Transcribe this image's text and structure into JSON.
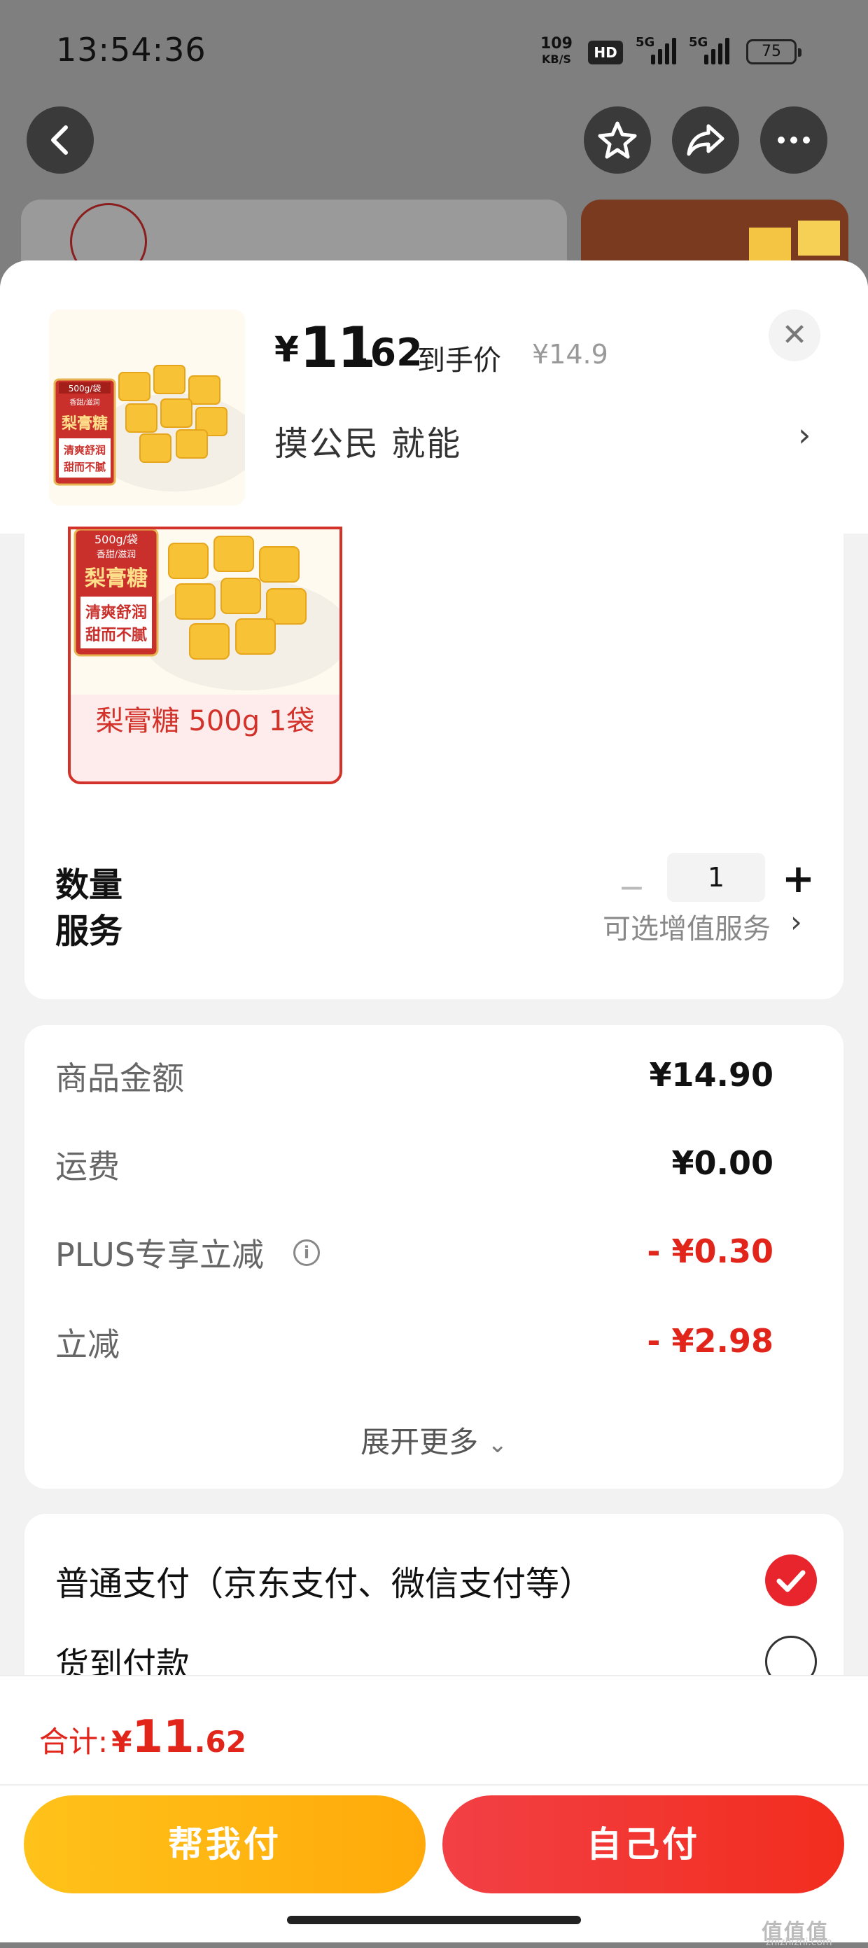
{
  "status_bar": {
    "time": "13:54:36",
    "net_speed_value": "109",
    "net_speed_unit": "KB/S",
    "hd_label": "HD",
    "sig1_label": "5G",
    "sig2_label": "5G",
    "battery": "75"
  },
  "nav": {
    "back_icon": "chevron-left-icon",
    "star_icon": "star-icon",
    "share_icon": "share-icon",
    "more_icon": "more-icon"
  },
  "product": {
    "price_symbol": "¥",
    "price_int": "11",
    "price_dec": ".62",
    "price_tag": "到手价",
    "original_price": "¥14.9",
    "promo_text": "摸公民  就能",
    "image_badge": "500g/袋",
    "image_sub": "香甜/滋润",
    "image_title": "梨膏糖",
    "image_slogan_1": "清爽舒润",
    "image_slogan_2": "甜而不腻"
  },
  "variant": {
    "label": "梨膏糖 500g 1袋",
    "selected": true
  },
  "quantity": {
    "label": "数量",
    "minus": "−",
    "value": "1",
    "plus": "+"
  },
  "service": {
    "label": "服务",
    "value": "可选增值服务"
  },
  "summary": {
    "items": [
      {
        "label": "商品金额",
        "value": "¥14.90"
      },
      {
        "label": "运费",
        "value": "¥0.00"
      },
      {
        "label": "PLUS专享立减",
        "value": "- ¥0.30"
      },
      {
        "label": "立减",
        "value": "- ¥2.98"
      }
    ],
    "expand": "展开更多"
  },
  "payment": {
    "option1": "普通支付（京东支付、微信支付等）",
    "option2": "货到付款",
    "selected": "option1"
  },
  "footer": {
    "total_label": "合计:",
    "total_symbol": "¥",
    "total_int": "11",
    "total_dec": ".62",
    "help_pay": "帮我付",
    "self_pay": "自己付"
  },
  "watermark": {
    "main": "值值值",
    "sub": "zhizhizhi.com"
  },
  "colors": {
    "accent_red": "#e1251b",
    "button_yellow": "#ffb312",
    "button_red": "#f2352f"
  }
}
